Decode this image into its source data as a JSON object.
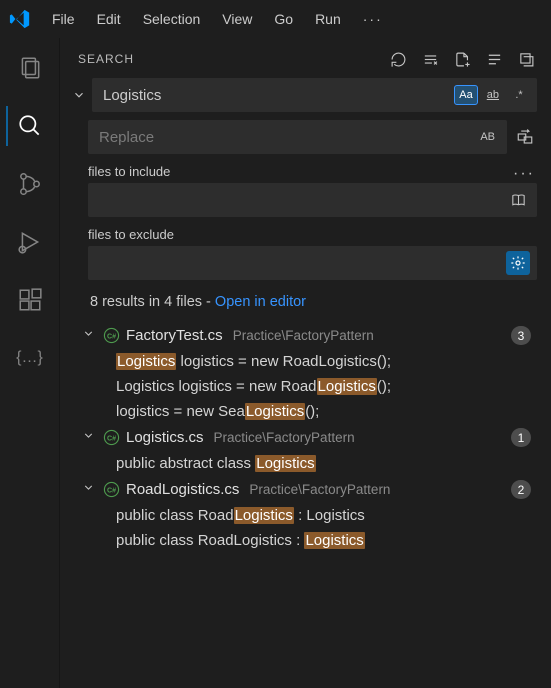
{
  "menu": {
    "items": [
      "File",
      "Edit",
      "Selection",
      "View",
      "Go",
      "Run"
    ]
  },
  "sidebar": {
    "title": "SEARCH"
  },
  "search": {
    "value": "Logistics",
    "match_case_label": "Aa",
    "whole_word_label": "ab",
    "regex_label": ".*",
    "replace_placeholder": "Replace",
    "preserve_case_label": "AB",
    "include_label": "files to include",
    "exclude_label": "files to exclude"
  },
  "summary": {
    "text": "8 results in 4 files - ",
    "link": "Open in editor"
  },
  "results": [
    {
      "file": "FactoryTest.cs",
      "path": "Practice\\FactoryPattern",
      "count": "3",
      "matches": [
        {
          "pre": "",
          "hl": "Logistics",
          "post": " logistics = new RoadLogistics();",
          "main": true
        },
        {
          "pre": "Logistics logistics = new Road",
          "hl": "Logistics",
          "post": "();"
        },
        {
          "pre": "logistics = new Sea",
          "hl": "Logistics",
          "post": "();"
        }
      ]
    },
    {
      "file": "Logistics.cs",
      "path": "Practice\\FactoryPattern",
      "count": "1",
      "matches": [
        {
          "pre": "public abstract class ",
          "hl": "Logistics",
          "post": ""
        }
      ]
    },
    {
      "file": "RoadLogistics.cs",
      "path": "Practice\\FactoryPattern",
      "count": "2",
      "matches": [
        {
          "pre": "public class Road",
          "hl": "Logistics",
          "post": " : Logistics"
        },
        {
          "pre": "public class RoadLogistics : ",
          "hl": "Logistics",
          "post": ""
        }
      ]
    }
  ]
}
